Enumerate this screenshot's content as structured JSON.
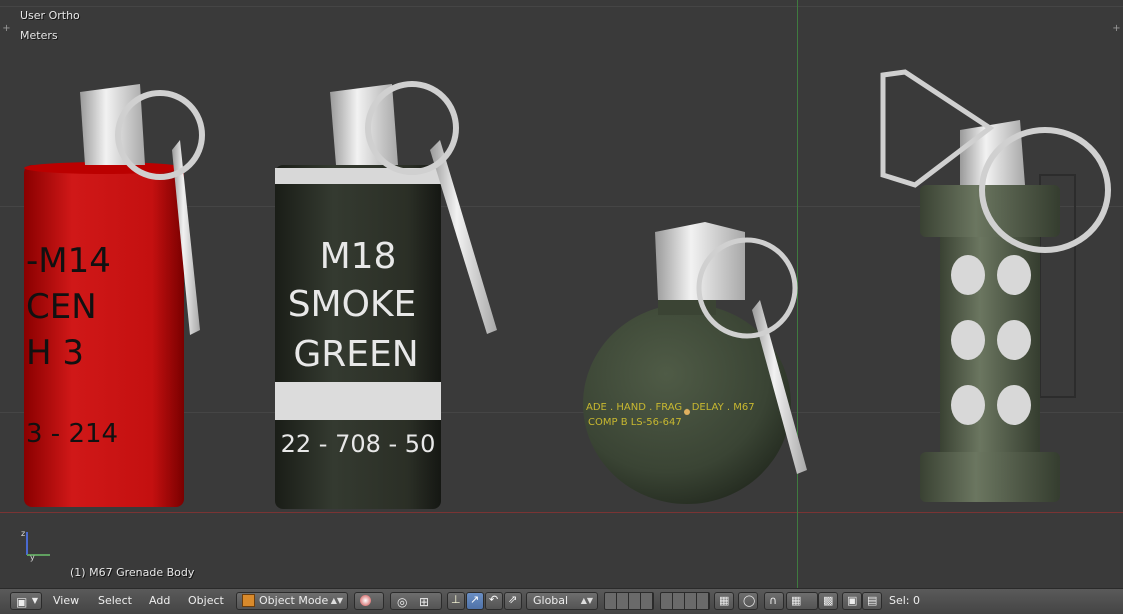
{
  "viewport": {
    "view_label": "User Ortho",
    "units_label": "Meters",
    "active_object_label": "(1) M67 Grenade Body",
    "objects": [
      {
        "name": "red-smoke-canister",
        "body_color": "#c41010",
        "text_lines": [
          "-M14",
          "CEN",
          "H 3",
          "3 - 214"
        ]
      },
      {
        "name": "m18-smoke-canister",
        "body_color": "#2b2f26",
        "text_lines": [
          "M18",
          "SMOKE",
          "GREEN",
          "22 - 708 - 50"
        ]
      },
      {
        "name": "m67-frag-grenade",
        "body_color": "#3f4a38",
        "text_lines": [
          "ADE . HAND . FRAG . DELAY . M67",
          "COMP B  LS-56-647"
        ]
      },
      {
        "name": "flashbang-grenade",
        "body_color": "#56614a",
        "text_lines": []
      }
    ]
  },
  "header": {
    "editor_type_icon": "3d-view-icon",
    "menus": [
      "View",
      "Select",
      "Add",
      "Object"
    ],
    "mode": "Object Mode",
    "transform_orientation": "Global",
    "selection_status": "Sel: 0"
  }
}
